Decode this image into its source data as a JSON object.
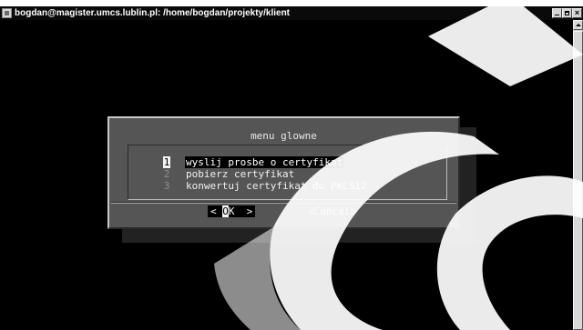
{
  "window": {
    "title": "bogdan@magister.umcs.lublin.pl: /home/bogdan/projekty/klient"
  },
  "dialog": {
    "title": "menu glowne",
    "items": [
      {
        "key": "1",
        "label": "wyslij prosbe o certyfikat",
        "selected": true
      },
      {
        "key": "2",
        "label": "pobierz certyfikat",
        "selected": false
      },
      {
        "key": "3",
        "label": "konwertuj certyfikat do PKCS12",
        "selected": false
      }
    ],
    "ok": {
      "left": "< ",
      "hot": "O",
      "rest": "K  >"
    },
    "cancel_label": "<Cancel>"
  },
  "colors": {
    "terminal_bg": "#000000",
    "dialog_bg": "#555555",
    "selection_bg": "#000000",
    "watermark": "#ffffff"
  }
}
